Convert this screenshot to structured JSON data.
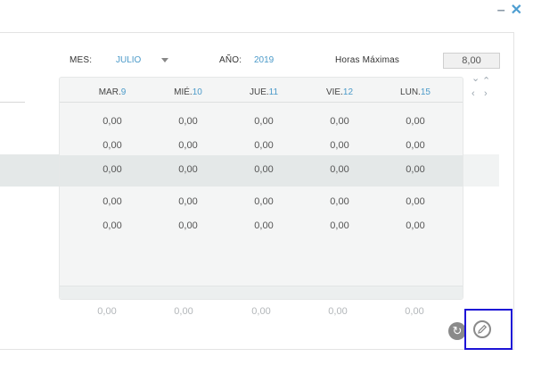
{
  "window": {
    "minimize_icon": "minimize-icon",
    "close_icon": "close-icon"
  },
  "filters": {
    "month_label": "MES:",
    "month_value": "JULIO",
    "year_label": "AÑO:",
    "year_value": "2019",
    "max_hours_label": "Horas Máximas",
    "max_hours_value": "8,00"
  },
  "days": [
    {
      "name": "MAR.",
      "num": "9"
    },
    {
      "name": "MIÉ.",
      "num": "10"
    },
    {
      "name": "JUE.",
      "num": "11"
    },
    {
      "name": "VIE.",
      "num": "12"
    },
    {
      "name": "LUN.",
      "num": "15"
    }
  ],
  "rows": [
    [
      "0,00",
      "0,00",
      "0,00",
      "0,00",
      "0,00"
    ],
    [
      "0,00",
      "0,00",
      "0,00",
      "0,00",
      "0,00"
    ],
    [
      "0,00",
      "0,00",
      "0,00",
      "0,00",
      "0,00"
    ],
    [
      "0,00",
      "0,00",
      "0,00",
      "0,00",
      "0,00"
    ],
    [
      "0,00",
      "0,00",
      "0,00",
      "0,00",
      "0,00"
    ]
  ],
  "totals": [
    "0,00",
    "0,00",
    "0,00",
    "0,00",
    "0,00"
  ],
  "actions": {
    "refresh_icon": "refresh-icon",
    "edit_icon": "edit-icon"
  },
  "colors": {
    "accent": "#4b9ac9",
    "focus": "#1d14d6"
  }
}
